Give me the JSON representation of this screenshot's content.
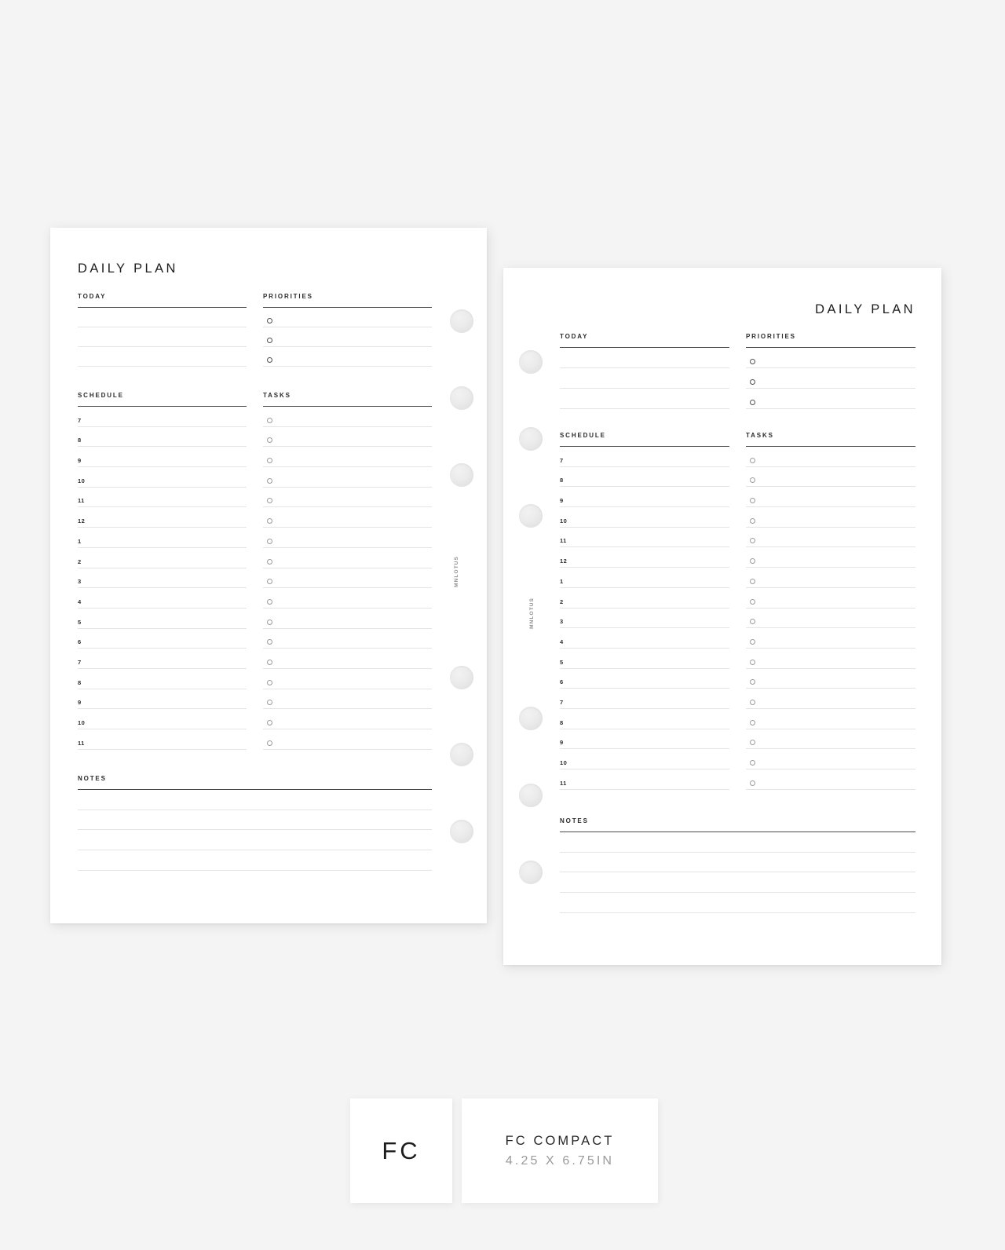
{
  "background_color": "#f4f4f4",
  "page_color": "#ffffff",
  "accent_rule_color": "#4a4a4a",
  "light_rule_color": "#e4e4e4",
  "pages": [
    {
      "id": "left",
      "title": "DAILY PLAN",
      "title_align": "left",
      "vertical_brand": "MNLOTUS",
      "sections": {
        "today": {
          "label": "TODAY",
          "line_count": 3
        },
        "priorities": {
          "label": "PRIORITIES",
          "line_count": 3
        },
        "schedule": {
          "label": "SCHEDULE",
          "hours": [
            "7",
            "8",
            "9",
            "10",
            "11",
            "12",
            "1",
            "2",
            "3",
            "4",
            "5",
            "6",
            "7",
            "8",
            "9",
            "10",
            "11"
          ]
        },
        "tasks": {
          "label": "TASKS",
          "line_count": 17
        },
        "notes": {
          "label": "NOTES",
          "line_count": 4
        }
      }
    },
    {
      "id": "right",
      "title": "DAILY PLAN",
      "title_align": "right",
      "vertical_brand": "MNLOTUS",
      "sections": {
        "today": {
          "label": "TODAY",
          "line_count": 3
        },
        "priorities": {
          "label": "PRIORITIES",
          "line_count": 3
        },
        "schedule": {
          "label": "SCHEDULE",
          "hours": [
            "7",
            "8",
            "9",
            "10",
            "11",
            "12",
            "1",
            "2",
            "3",
            "4",
            "5",
            "6",
            "7",
            "8",
            "9",
            "10",
            "11"
          ]
        },
        "tasks": {
          "label": "TASKS",
          "line_count": 17
        },
        "notes": {
          "label": "NOTES",
          "line_count": 4
        }
      }
    }
  ],
  "branding": {
    "badge_label": "FC",
    "product_name": "FC COMPACT",
    "product_size": "4.25 X 6.75IN"
  }
}
